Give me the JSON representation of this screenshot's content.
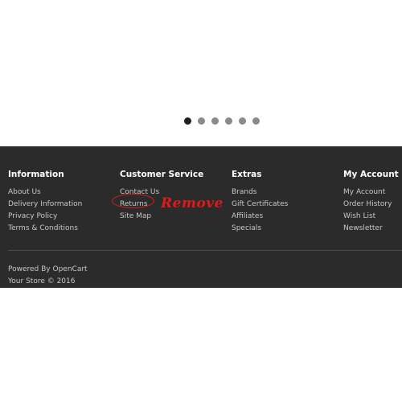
{
  "carousel": {
    "dots": [
      {
        "active": true
      },
      {
        "active": false
      },
      {
        "active": false
      },
      {
        "active": false
      },
      {
        "active": false
      },
      {
        "active": false
      }
    ]
  },
  "footer": {
    "columns": [
      {
        "heading": "Information",
        "links": [
          "About Us",
          "Delivery Information",
          "Privacy Policy",
          "Terms & Conditions"
        ]
      },
      {
        "heading": "Customer Service",
        "links": [
          "Contact Us",
          "Returns",
          "Site Map"
        ]
      },
      {
        "heading": "Extras",
        "links": [
          "Brands",
          "Gift Certificates",
          "Affiliates",
          "Specials"
        ]
      },
      {
        "heading": "My Account",
        "links": [
          "My Account",
          "Order History",
          "Wish List",
          "Newsletter"
        ]
      }
    ],
    "powered_prefix": "Powered By",
    "powered_link": "OpenCart",
    "copyright": "Your Store © 2016"
  },
  "annotation": {
    "text": "Remove",
    "color": "#e01a1a"
  },
  "colors": {
    "footer_bg": "#2b2b2b",
    "link": "#c8c8c8",
    "heading": "#ffffff",
    "dot_active": "#1f1f1f",
    "dot_inactive": "#8a8a8a"
  }
}
